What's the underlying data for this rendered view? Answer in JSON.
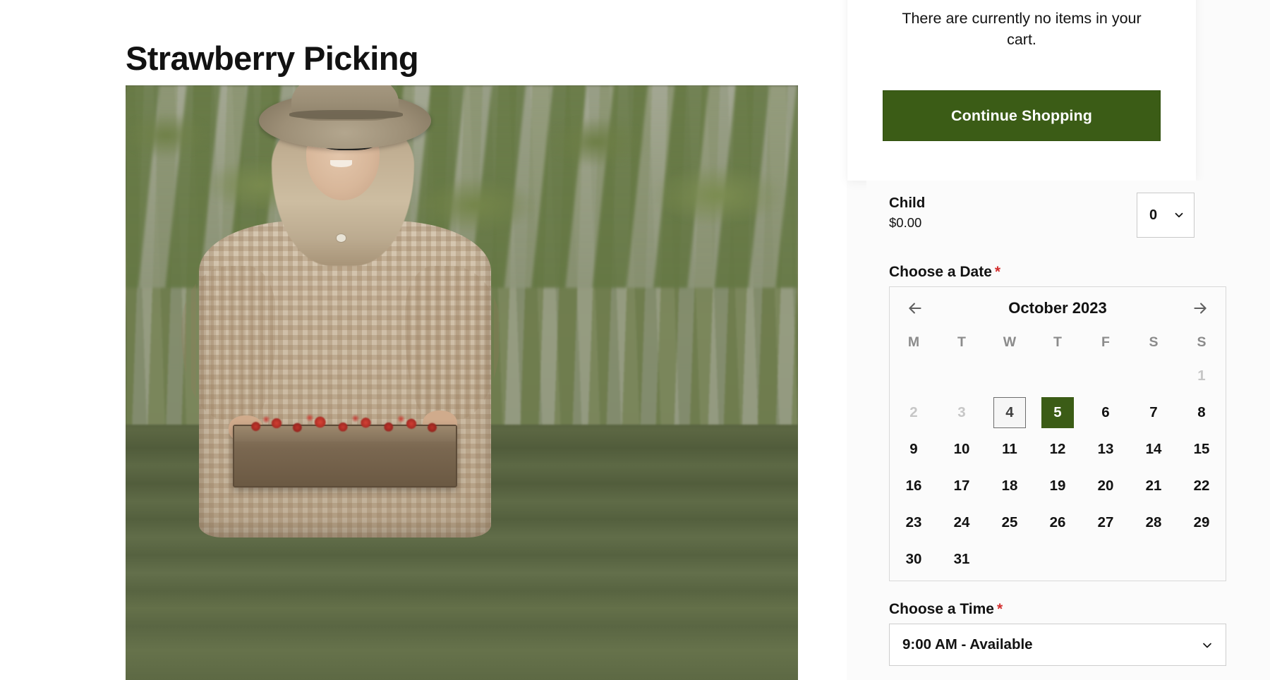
{
  "page": {
    "title": "Strawberry Picking",
    "hero_alt": "woman-in-hat-holding-crate-of-strawberries-in-field"
  },
  "cart": {
    "empty_message": "There are currently no items in your cart.",
    "continue_button": "Continue Shopping"
  },
  "booking": {
    "ticket": {
      "name": "Child",
      "price": "$0.00",
      "quantity": "0"
    },
    "date_label": "Choose a Date",
    "time_label": "Choose a Time",
    "required_marker": "*",
    "calendar": {
      "month": "October 2023",
      "prev_arrow": "←",
      "next_arrow": "→",
      "weekdays": [
        "M",
        "T",
        "W",
        "T",
        "F",
        "S",
        "S"
      ],
      "leading_blanks": 6,
      "days": [
        {
          "n": "1",
          "state": "disabled"
        },
        {
          "n": "2",
          "state": "disabled"
        },
        {
          "n": "3",
          "state": "disabled"
        },
        {
          "n": "4",
          "state": "today"
        },
        {
          "n": "5",
          "state": "selected"
        },
        {
          "n": "6",
          "state": "normal"
        },
        {
          "n": "7",
          "state": "normal"
        },
        {
          "n": "8",
          "state": "normal"
        },
        {
          "n": "9",
          "state": "normal"
        },
        {
          "n": "10",
          "state": "normal"
        },
        {
          "n": "11",
          "state": "normal"
        },
        {
          "n": "12",
          "state": "normal"
        },
        {
          "n": "13",
          "state": "normal"
        },
        {
          "n": "14",
          "state": "normal"
        },
        {
          "n": "15",
          "state": "normal"
        },
        {
          "n": "16",
          "state": "normal"
        },
        {
          "n": "17",
          "state": "normal"
        },
        {
          "n": "18",
          "state": "normal"
        },
        {
          "n": "19",
          "state": "normal"
        },
        {
          "n": "20",
          "state": "normal"
        },
        {
          "n": "21",
          "state": "normal"
        },
        {
          "n": "22",
          "state": "normal"
        },
        {
          "n": "23",
          "state": "normal"
        },
        {
          "n": "24",
          "state": "normal"
        },
        {
          "n": "25",
          "state": "normal"
        },
        {
          "n": "26",
          "state": "normal"
        },
        {
          "n": "27",
          "state": "normal"
        },
        {
          "n": "28",
          "state": "normal"
        },
        {
          "n": "29",
          "state": "normal"
        },
        {
          "n": "30",
          "state": "normal"
        },
        {
          "n": "31",
          "state": "normal"
        }
      ]
    },
    "time_value": "9:00 AM - Available"
  },
  "colors": {
    "brand_green": "#3b5c16",
    "required_red": "#d32f2f",
    "text": "#121212",
    "muted": "#8b8b8b",
    "disabled": "#c6c6c6"
  }
}
